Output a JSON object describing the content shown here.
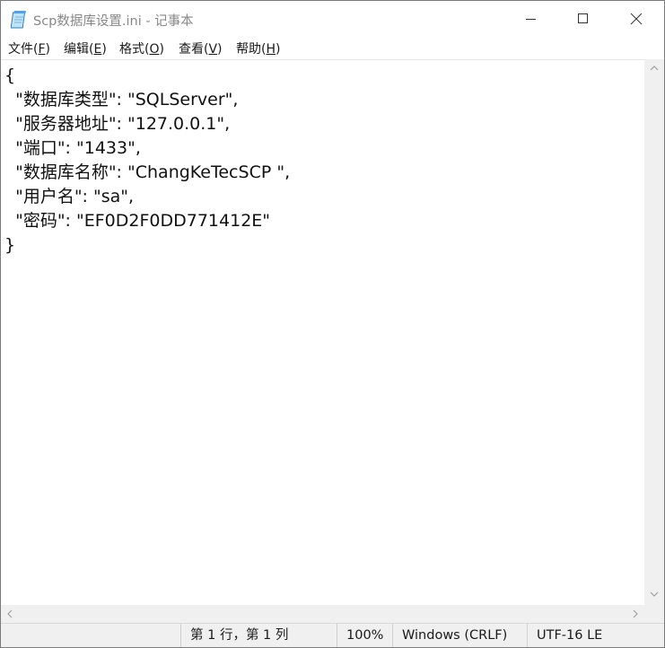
{
  "window": {
    "title": "Scp数据库设置.ini - 记事本",
    "icon": "notepad-icon"
  },
  "caption_buttons": {
    "minimize_icon": "minimize-icon",
    "maximize_icon": "maximize-icon",
    "close_icon": "close-icon"
  },
  "menu": {
    "items": [
      {
        "label": "文件(",
        "acc": "F",
        "tail": ")"
      },
      {
        "label": "编辑(",
        "acc": "E",
        "tail": ")"
      },
      {
        "label": "格式(",
        "acc": "O",
        "tail": ")"
      },
      {
        "label": "查看(",
        "acc": "V",
        "tail": ")"
      },
      {
        "label": "帮助(",
        "acc": "H",
        "tail": ")"
      }
    ]
  },
  "editor": {
    "lines": [
      "{",
      "  \"数据库类型\": \"SQLServer\",",
      "  \"服务器地址\": \"127.0.0.1\",",
      "  \"端口\": \"1433\",",
      "  \"数据库名称\": \"ChangKeTecSCP \",",
      "  \"用户名\": \"sa\",",
      "  \"密码\": \"EF0D2F0DD771412E\"",
      "}"
    ]
  },
  "statusbar": {
    "position": "第 1 行，第 1 列",
    "zoom": "100%",
    "line_ending": "Windows (CRLF)",
    "encoding": "UTF-16 LE"
  },
  "colors": {
    "title_text": "#888888",
    "chrome_bg": "#f0f0f0",
    "text": "#111111"
  }
}
